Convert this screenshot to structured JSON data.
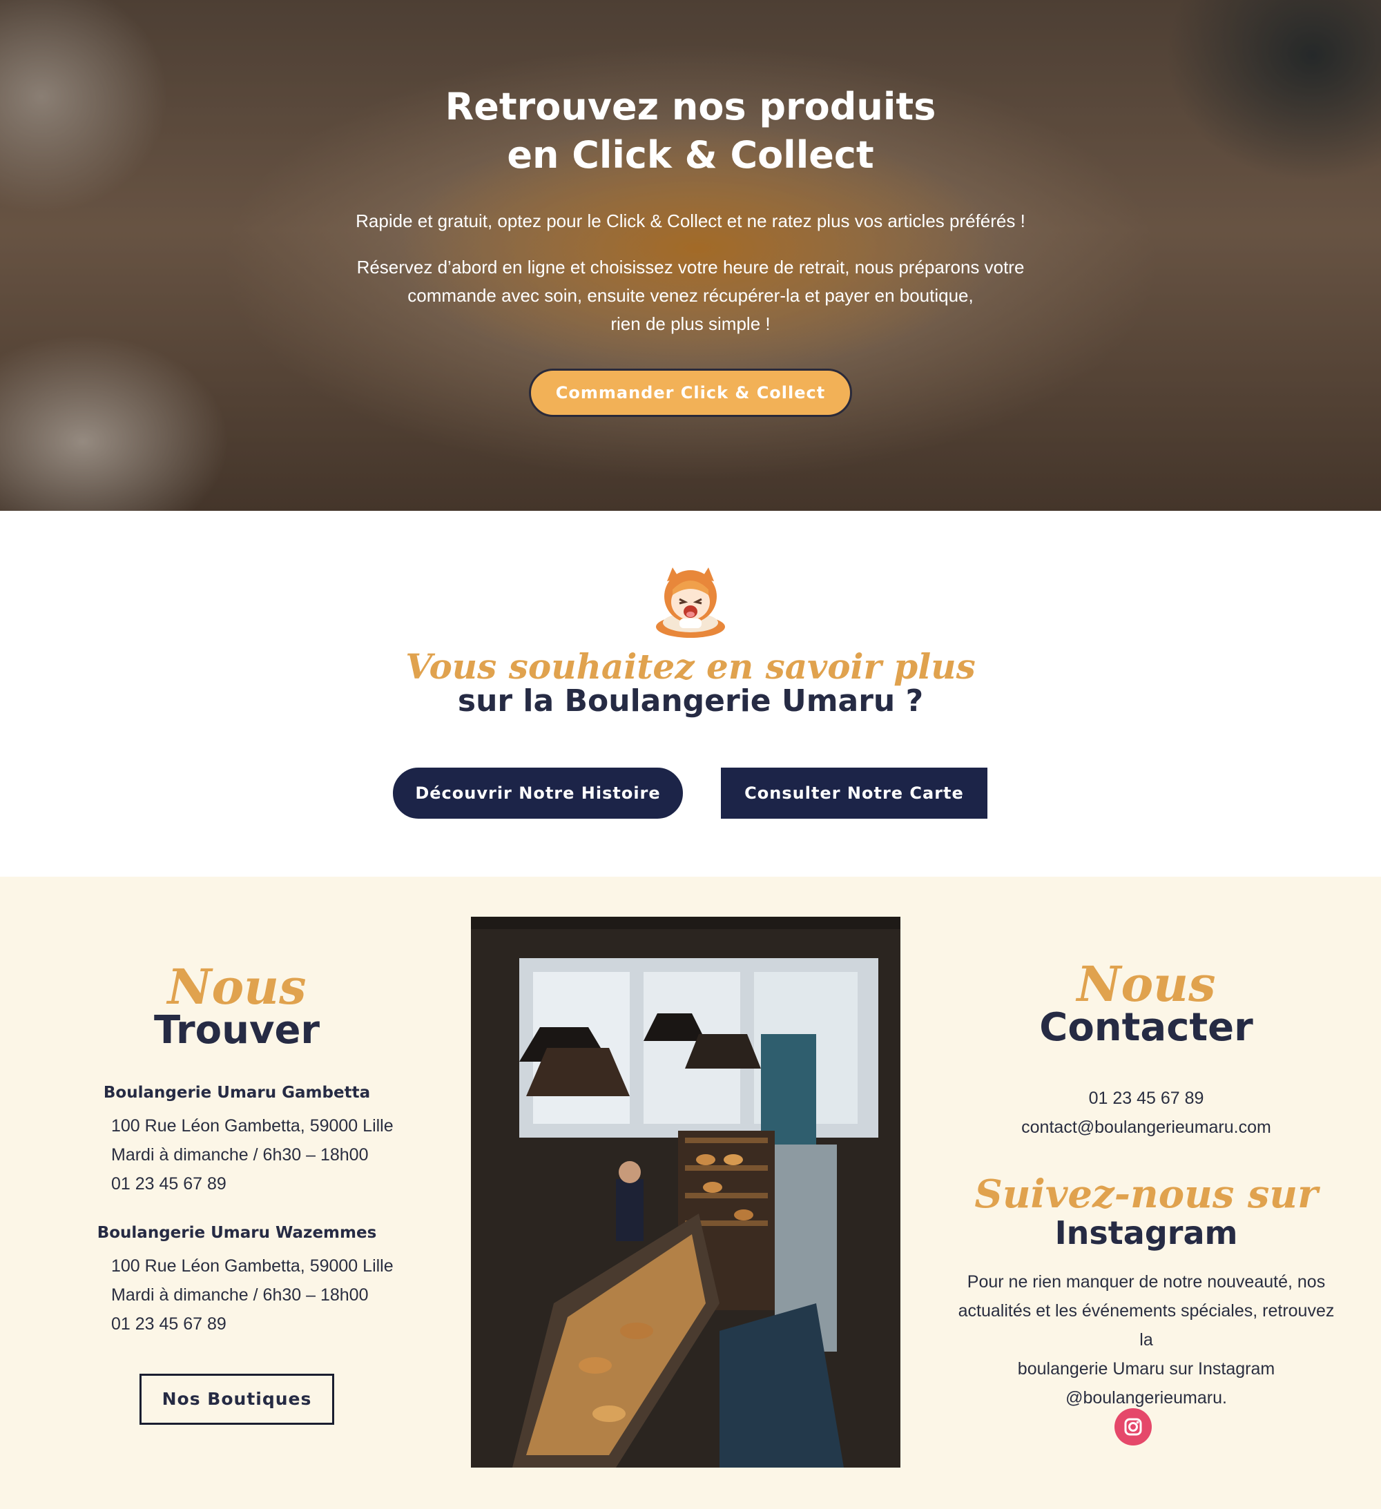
{
  "hero": {
    "title_line1": "Retrouvez nos produits",
    "title_line2": "en Click & Collect",
    "paragraph1": "Rapide et gratuit, optez pour le Click & Collect et ne ratez plus vos articles préférés !",
    "paragraph2_line1": "Réservez d’abord en ligne et choisissez votre heure de retrait, nous préparons votre",
    "paragraph2_line2": "commande avec soin, ensuite venez récupérer-la et payer en boutique,",
    "paragraph2_line3": "rien de plus simple !",
    "cta_label": "Commander Click & Collect"
  },
  "about": {
    "script": "Vous souhaitez en savoir plus",
    "title": "sur la Boulangerie Umaru ?",
    "button_history": "Découvrir Notre Histoire",
    "button_menu": "Consulter Notre Carte"
  },
  "find_us": {
    "script": "Nous",
    "title": "Trouver",
    "shops": [
      {
        "name": "Boulangerie Umaru Gambetta",
        "address": "100 Rue Léon Gambetta, 59000 Lille",
        "hours": "Mardi à dimanche / 6h30 – 18h00",
        "phone": "01 23 45 67 89"
      },
      {
        "name": "Boulangerie Umaru Wazemmes",
        "address": "100 Rue Léon Gambetta, 59000 Lille",
        "hours": "Mardi à dimanche / 6h30 – 18h00",
        "phone": "01 23 45 67 89"
      }
    ],
    "button_label": "Nos Boutiques"
  },
  "contact": {
    "script": "Nous",
    "title": "Contacter",
    "phone": "01 23 45 67 89",
    "email": "contact@boulangerieumaru.com"
  },
  "instagram": {
    "script": "Suivez-nous sur",
    "title": "Instagram",
    "text_line1": "Pour ne rien manquer de notre nouveauté, nos",
    "text_line2": "actualités et les événements spéciales, retrouvez la",
    "text_line3": "boulangerie Umaru sur Instagram",
    "text_line4": "@boulangerieumaru.",
    "icon": "instagram-icon"
  },
  "colors": {
    "accent": "#f2b157",
    "script": "#e0a24e",
    "navy": "#1c2448",
    "cream": "#fcf6e7",
    "instagram": "#e5486a"
  }
}
